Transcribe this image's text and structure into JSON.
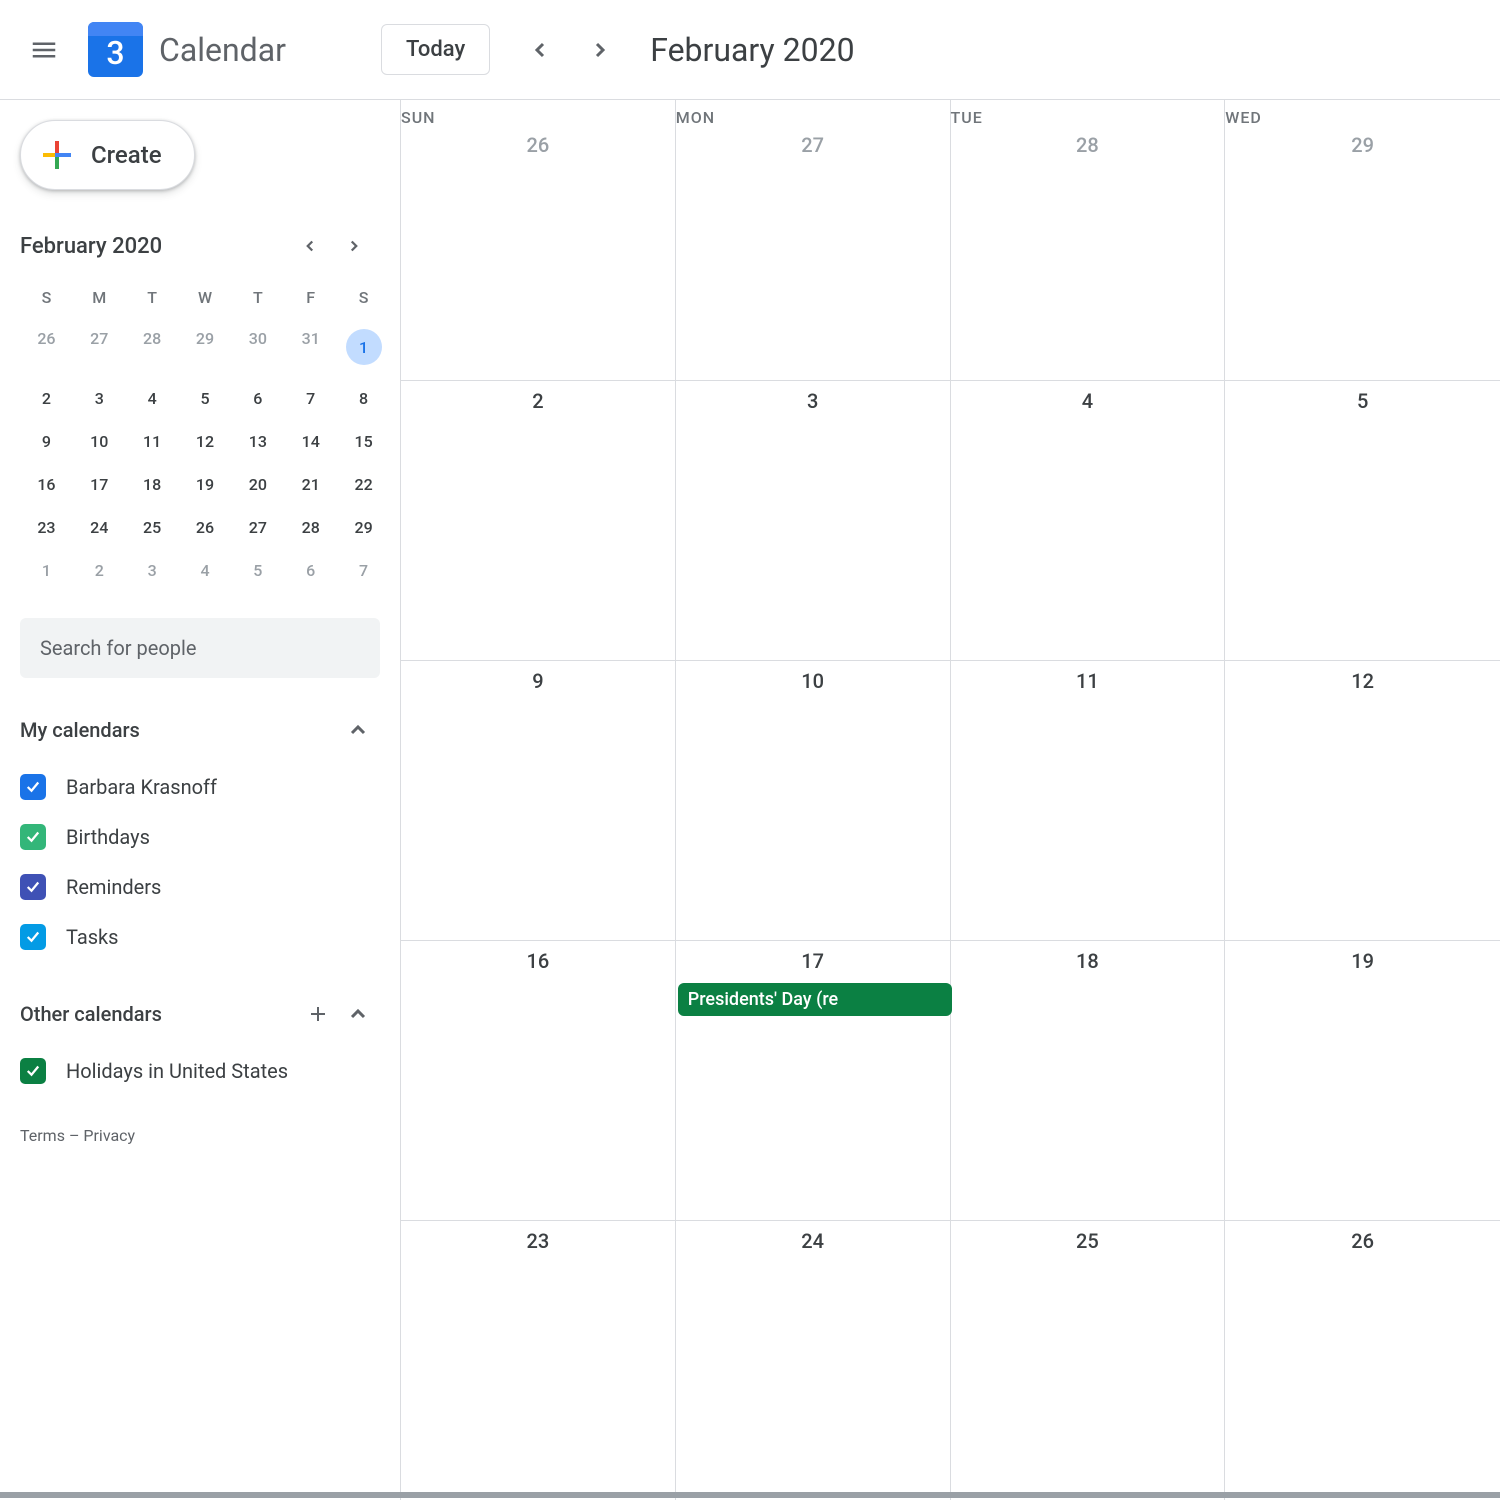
{
  "header": {
    "app_name": "Calendar",
    "logo_day": "3",
    "today_label": "Today",
    "month_title": "February 2020"
  },
  "create": {
    "label": "Create"
  },
  "mini_cal": {
    "title": "February 2020",
    "weekdays": [
      "S",
      "M",
      "T",
      "W",
      "T",
      "F",
      "S"
    ],
    "rows": [
      [
        {
          "n": "26",
          "out": true
        },
        {
          "n": "27",
          "out": true
        },
        {
          "n": "28",
          "out": true
        },
        {
          "n": "29",
          "out": true
        },
        {
          "n": "30",
          "out": true
        },
        {
          "n": "31",
          "out": true
        },
        {
          "n": "1",
          "today": true
        }
      ],
      [
        {
          "n": "2"
        },
        {
          "n": "3"
        },
        {
          "n": "4"
        },
        {
          "n": "5"
        },
        {
          "n": "6"
        },
        {
          "n": "7"
        },
        {
          "n": "8"
        }
      ],
      [
        {
          "n": "9"
        },
        {
          "n": "10"
        },
        {
          "n": "11"
        },
        {
          "n": "12"
        },
        {
          "n": "13"
        },
        {
          "n": "14"
        },
        {
          "n": "15"
        }
      ],
      [
        {
          "n": "16"
        },
        {
          "n": "17"
        },
        {
          "n": "18"
        },
        {
          "n": "19"
        },
        {
          "n": "20"
        },
        {
          "n": "21"
        },
        {
          "n": "22"
        }
      ],
      [
        {
          "n": "23"
        },
        {
          "n": "24"
        },
        {
          "n": "25"
        },
        {
          "n": "26"
        },
        {
          "n": "27"
        },
        {
          "n": "28"
        },
        {
          "n": "29"
        }
      ],
      [
        {
          "n": "1",
          "out": true
        },
        {
          "n": "2",
          "out": true
        },
        {
          "n": "3",
          "out": true
        },
        {
          "n": "4",
          "out": true
        },
        {
          "n": "5",
          "out": true
        },
        {
          "n": "6",
          "out": true
        },
        {
          "n": "7",
          "out": true
        }
      ]
    ]
  },
  "search": {
    "placeholder": "Search for people"
  },
  "my_calendars": {
    "title": "My calendars",
    "items": [
      {
        "label": "Barbara Krasnoff",
        "color": "#1a73e8"
      },
      {
        "label": "Birthdays",
        "color": "#33b679"
      },
      {
        "label": "Reminders",
        "color": "#3f51b5"
      },
      {
        "label": "Tasks",
        "color": "#039be5"
      }
    ]
  },
  "other_calendars": {
    "title": "Other calendars",
    "items": [
      {
        "label": "Holidays in United States",
        "color": "#0b8043"
      }
    ]
  },
  "footer": {
    "terms": "Terms",
    "sep": " – ",
    "privacy": "Privacy"
  },
  "grid": {
    "weekdays": [
      "SUN",
      "MON",
      "TUE",
      "WED"
    ],
    "rows": [
      [
        {
          "n": "26",
          "out": true
        },
        {
          "n": "27",
          "out": true
        },
        {
          "n": "28",
          "out": true
        },
        {
          "n": "29",
          "out": true
        }
      ],
      [
        {
          "n": "2"
        },
        {
          "n": "3"
        },
        {
          "n": "4"
        },
        {
          "n": "5"
        }
      ],
      [
        {
          "n": "9"
        },
        {
          "n": "10"
        },
        {
          "n": "11"
        },
        {
          "n": "12"
        }
      ],
      [
        {
          "n": "16"
        },
        {
          "n": "17",
          "events": [
            {
              "label": "Presidents' Day (re"
            }
          ]
        },
        {
          "n": "18"
        },
        {
          "n": "19"
        }
      ],
      [
        {
          "n": "23"
        },
        {
          "n": "24"
        },
        {
          "n": "25"
        },
        {
          "n": "26"
        }
      ]
    ]
  }
}
